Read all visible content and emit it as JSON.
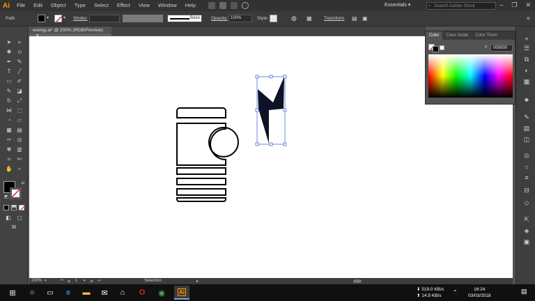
{
  "menubar": {
    "logo": "Ai",
    "items": [
      "File",
      "Edit",
      "Object",
      "Type",
      "Select",
      "Effect",
      "View",
      "Window",
      "Help"
    ],
    "workspace": "Essentials",
    "search_placeholder": "Search Adobe Stock"
  },
  "control": {
    "selection": "Path",
    "stroke_label": "Stroke:",
    "brush_label": "Basic",
    "opacity_label": "Opacity:",
    "opacity_value": "100%",
    "style_label": "Style:",
    "transform_label": "Transform"
  },
  "document": {
    "tab_title": "energy.ai* @ 200% (RGB/Preview)"
  },
  "color_panel": {
    "tabs": [
      "Color",
      "Color Guide",
      "Color Them"
    ],
    "hash": "#",
    "hex_value": "000000"
  },
  "status": {
    "zoom": "200%",
    "artboard_num": "1",
    "tool_name": "Selection"
  },
  "taskbar": {
    "net_down": "519.0 KB/s",
    "net_up": "14.9 KB/s",
    "time": "16:24",
    "date": "03/03/2018"
  },
  "colors": {
    "app_bg": "#535353",
    "menubar_bg": "#323232",
    "artboard_bg": "#ffffff",
    "ai_orange": "#ff9a00",
    "selection_blue": "#4a6fd8",
    "bolt_fill": "#0d1226"
  }
}
